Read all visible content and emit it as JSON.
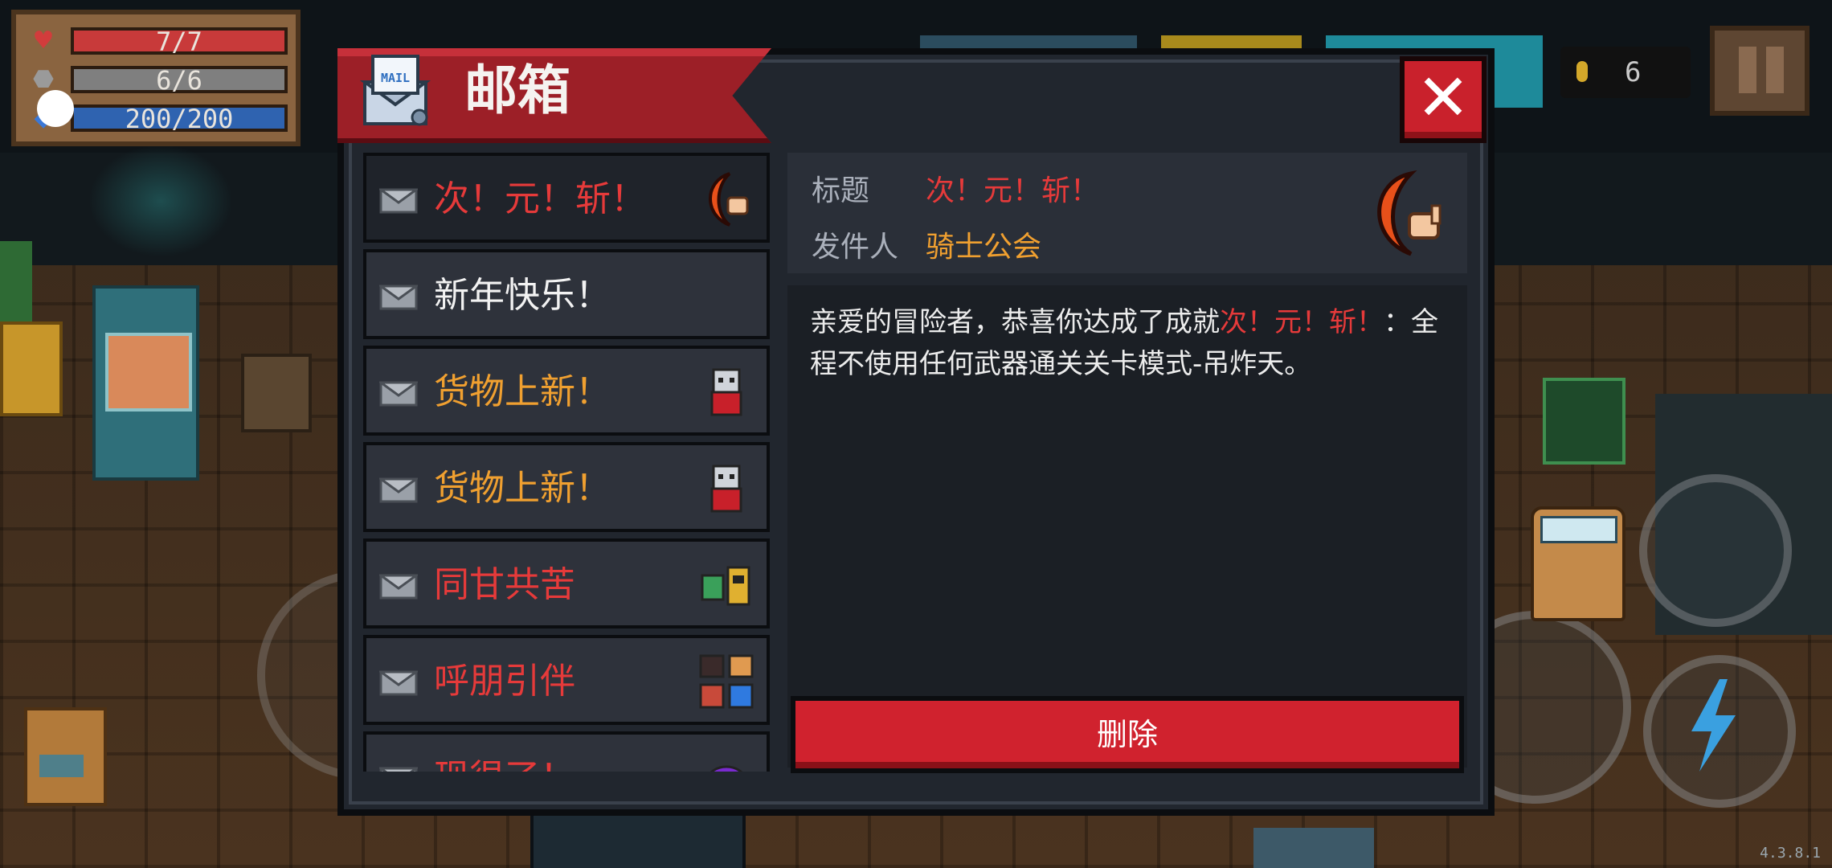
{
  "hud": {
    "hp": "7/7",
    "shield": "6/6",
    "energy": "200/200",
    "coins": "6"
  },
  "dialog": {
    "title": "邮箱",
    "mail_icon_text": "MAIL",
    "delete_label": "删除"
  },
  "mail_list": [
    {
      "title": "次！元！斩！",
      "color": "#e63a3a",
      "icon": "crescent-slash-icon",
      "selected": true
    },
    {
      "title": "新年快乐！",
      "color": "#f2f2f2",
      "icon": "",
      "selected": false
    },
    {
      "title": "货物上新！",
      "color": "#f0a030",
      "icon": "merchant-icon",
      "selected": false
    },
    {
      "title": "货物上新！",
      "color": "#f0a030",
      "icon": "merchant-icon",
      "selected": false
    },
    {
      "title": "同甘共苦",
      "color": "#e63a3a",
      "icon": "team-icon",
      "selected": false
    },
    {
      "title": "呼朋引伴",
      "color": "#e63a3a",
      "icon": "friends-icon",
      "selected": false
    },
    {
      "title": "现很了！",
      "color": "#e63a3a",
      "icon": "purple-creature-icon",
      "selected": false
    }
  ],
  "detail": {
    "title_key": "标题",
    "title_value": "次！元！斩！",
    "sender_key": "发件人",
    "sender_value": "骑士公会",
    "body_prefix": "亲爱的冒险者，恭喜你达成了成就",
    "body_highlight": "次！元！斩！",
    "body_suffix": "：全程不使用任何武器通关关卡模式-吊炸天。"
  },
  "version": "4.3.8.1"
}
